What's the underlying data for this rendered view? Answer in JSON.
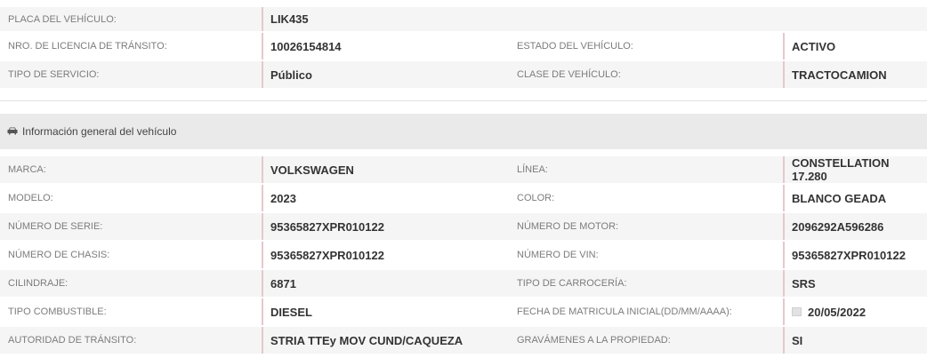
{
  "top": {
    "placa_label": "PLACA DEL VEHÍCULO:",
    "placa_value": "LIK435",
    "licencia_label": "NRO. DE LICENCIA DE TRÁNSITO:",
    "licencia_value": "10026154814",
    "estado_label": "ESTADO DEL VEHÍCULO:",
    "estado_value": "ACTIVO",
    "servicio_label": "TIPO DE SERVICIO:",
    "servicio_value": "Público",
    "clase_label": "CLASE DE VEHÍCULO:",
    "clase_value": "TRACTOCAMION"
  },
  "section": {
    "icon": "car-icon",
    "title": "Información general del vehículo"
  },
  "general": [
    {
      "l1": "MARCA:",
      "v1": "VOLKSWAGEN",
      "l2": "LÍNEA:",
      "v2": "CONSTELLATION 17.280"
    },
    {
      "l1": "MODELO:",
      "v1": "2023",
      "l2": "COLOR:",
      "v2": "BLANCO GEADA"
    },
    {
      "l1": "NÚMERO DE SERIE:",
      "v1": "95365827XPR010122",
      "l2": "NÚMERO DE MOTOR:",
      "v2": "2096292A596286"
    },
    {
      "l1": "NÚMERO DE CHASIS:",
      "v1": "95365827XPR010122",
      "l2": "NÚMERO DE VIN:",
      "v2": "95365827XPR010122"
    },
    {
      "l1": "CILINDRAJE:",
      "v1": "6871",
      "l2": "TIPO DE CARROCERÍA:",
      "v2": "SRS"
    },
    {
      "l1": "TIPO COMBUSTIBLE:",
      "v1": "DIESEL",
      "l2": "FECHA DE MATRICULA INICIAL(DD/MM/AAAA):",
      "v2": "20/05/2022",
      "v2_icon": "calendar-icon"
    },
    {
      "l1": "AUTORIDAD DE TRÁNSITO:",
      "v1": "STRIA TTEy MOV CUND/CAQUEZA",
      "l2": "GRAVÁMENES A LA PROPIEDAD:",
      "v2": "SI"
    }
  ],
  "colors": {
    "row_alt_bg": "#f5f5f5",
    "section_bg": "#eaeaea",
    "value_border": "#e4c9cb"
  }
}
